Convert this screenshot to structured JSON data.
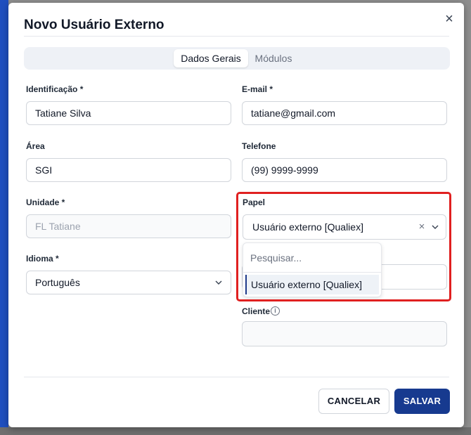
{
  "modal": {
    "title": "Novo Usuário Externo"
  },
  "tabs": [
    {
      "label": "Dados Gerais",
      "active": true
    },
    {
      "label": "Módulos",
      "active": false
    }
  ],
  "fields": {
    "identificacao": {
      "label": "Identificação *",
      "value": "Tatiane Silva"
    },
    "email": {
      "label": "E-mail *",
      "value": "tatiane@gmail.com"
    },
    "area": {
      "label": "Área",
      "value": "SGI"
    },
    "telefone": {
      "label": "Telefone",
      "value": "(99) 9999-9999"
    },
    "unidade": {
      "label": "Unidade *",
      "value": "FL Tatiane"
    },
    "papel": {
      "label": "Papel",
      "value": "Usuário externo [Qualiex]"
    },
    "idioma": {
      "label": "Idioma *",
      "value": "Português"
    },
    "cliente": {
      "label": "Cliente",
      "value": ""
    }
  },
  "dropdown": {
    "search_placeholder": "Pesquisar...",
    "options": [
      "Usuário externo [Qualiex]"
    ]
  },
  "buttons": {
    "cancel": "CANCELAR",
    "save": "SALVAR"
  },
  "icons": {
    "close": "close-icon",
    "clear": "clear-icon",
    "chevron": "chevron-down-icon",
    "info": "info-icon"
  },
  "colors": {
    "primary": "#173a8f",
    "highlight": "#e02020"
  }
}
